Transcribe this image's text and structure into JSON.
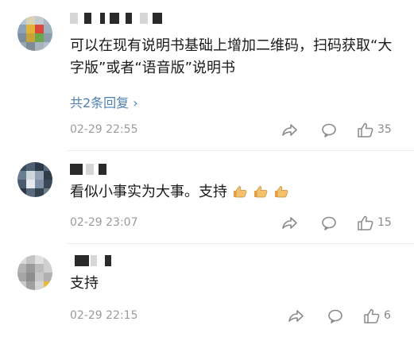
{
  "comments": [
    {
      "text": "可以在现有说明书基础上增加二维码，扫码获取“大字版”或者“语音版”说明书",
      "replies_label": "共2条回复 ›",
      "date": "02-29 22:55",
      "likes": "35"
    },
    {
      "text": "看似小事实为大事。支持",
      "emojis": [
        "thumbs-up-emoji",
        "thumbs-up-emoji",
        "thumbs-up-emoji"
      ],
      "date": "02-29 23:07",
      "likes": "15"
    },
    {
      "text": "支持",
      "date": "02-29 22:15",
      "likes": "6"
    }
  ],
  "icons": {
    "share": "share-icon",
    "comment": "comment-icon",
    "like": "like-icon"
  },
  "colors": {
    "reply_link": "#4f7fb4",
    "meta_text": "#9b9b9b",
    "icon": "#8a8a8a"
  }
}
